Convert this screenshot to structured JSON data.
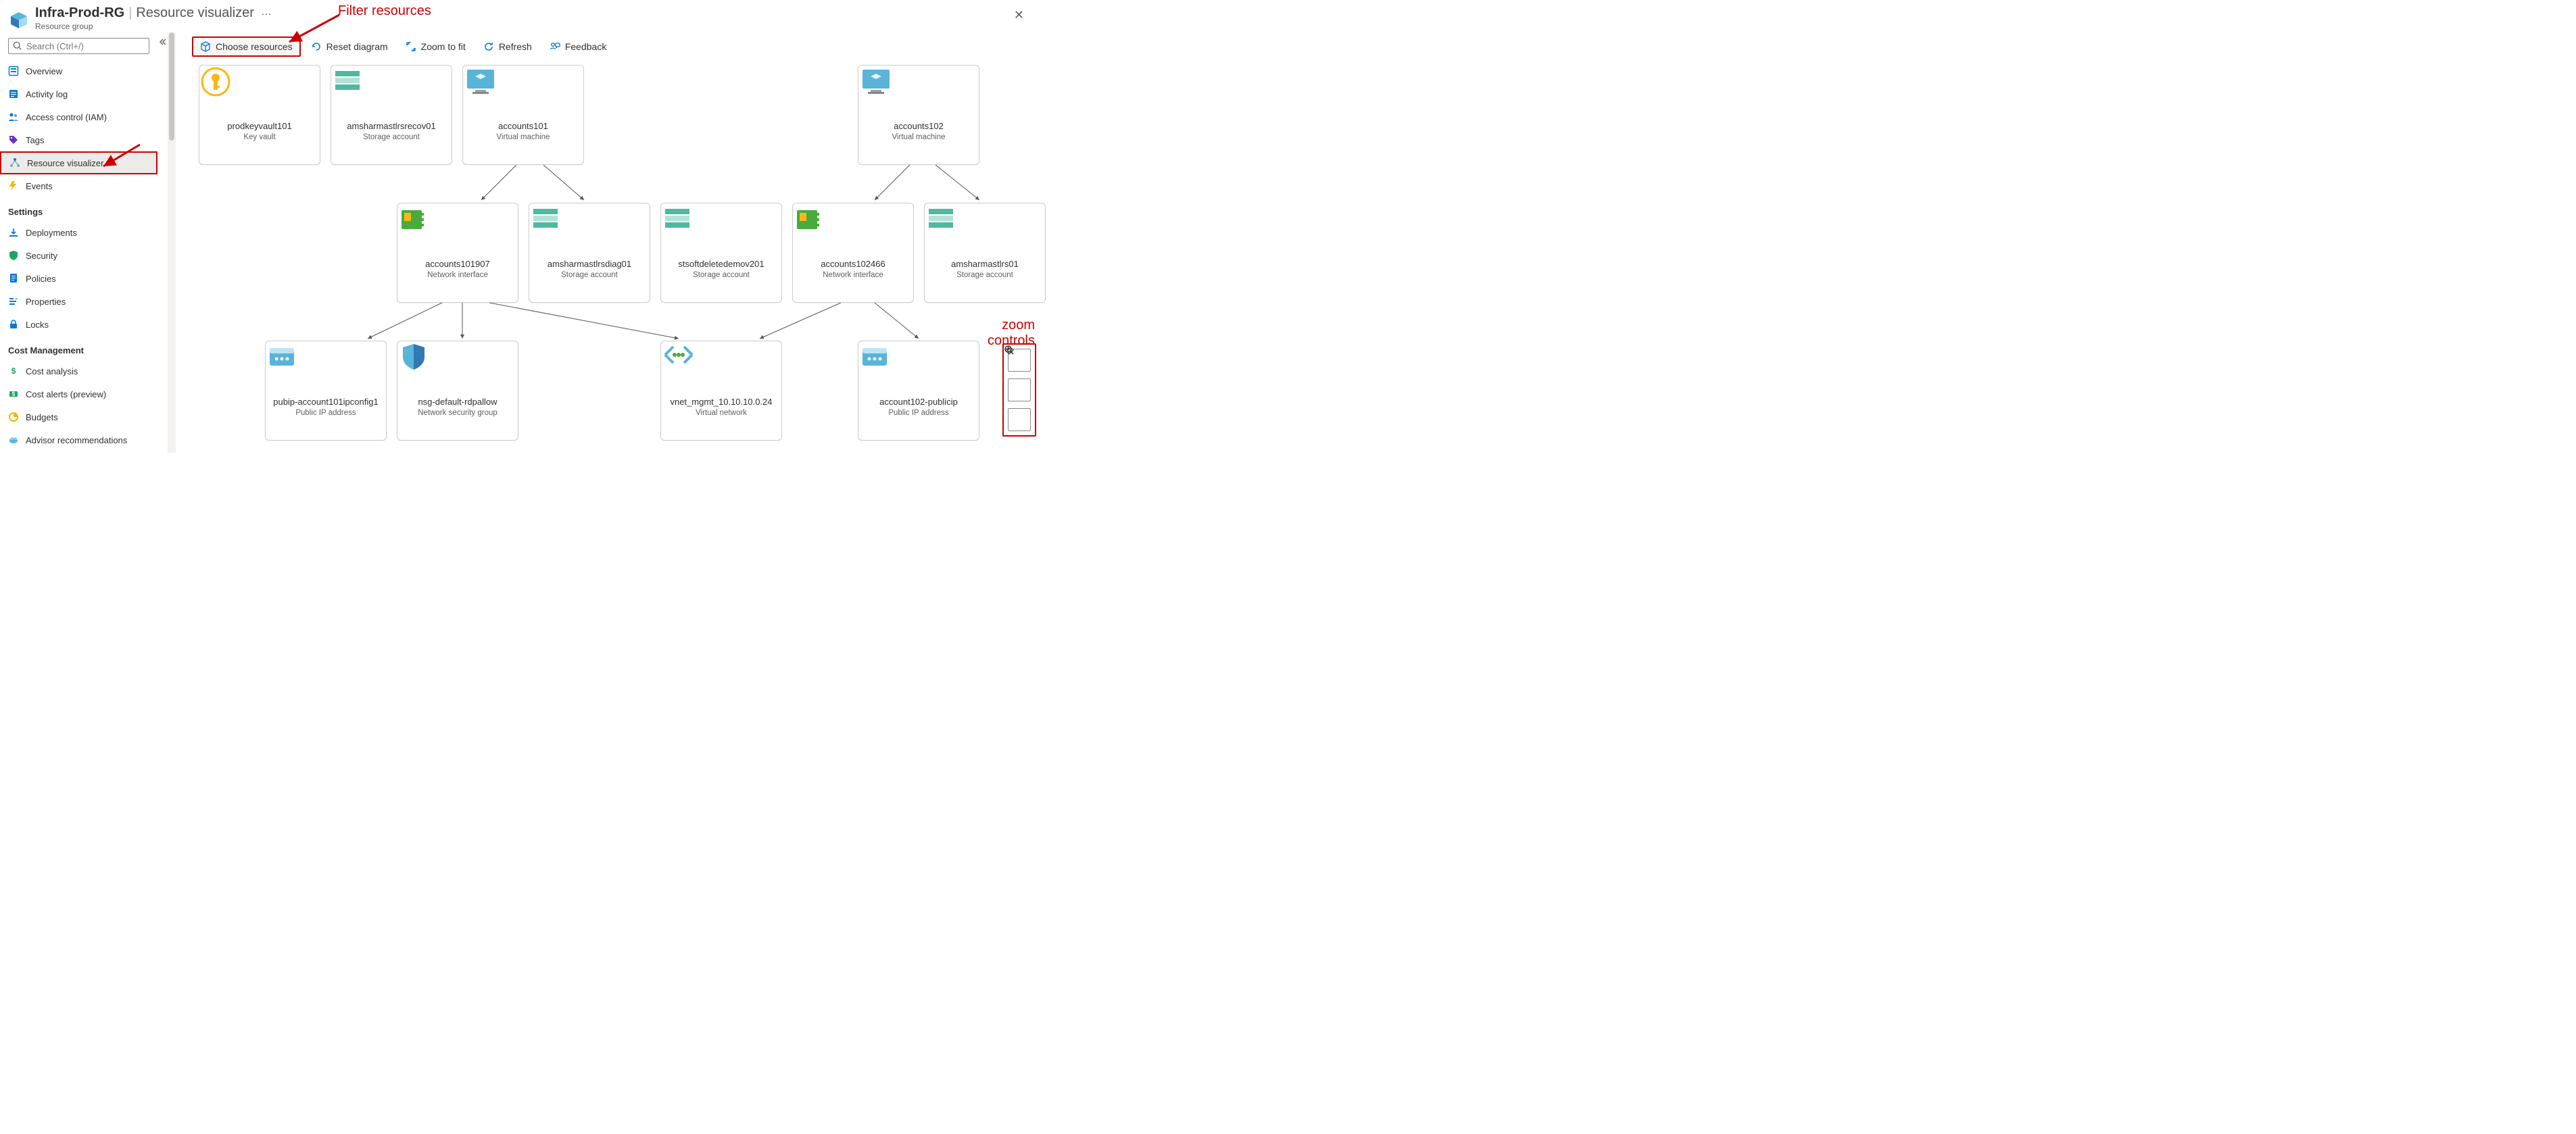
{
  "header": {
    "title_main": "Infra-Prod-RG",
    "title_separator": "|",
    "title_sub": "Resource visualizer",
    "subtitle": "Resource group",
    "more": "…"
  },
  "search": {
    "placeholder": "Search (Ctrl+/)"
  },
  "sidebar": {
    "items": [
      {
        "label": "Overview",
        "icon": "overview-icon"
      },
      {
        "label": "Activity log",
        "icon": "activitylog-icon"
      },
      {
        "label": "Access control (IAM)",
        "icon": "iam-icon"
      },
      {
        "label": "Tags",
        "icon": "tags-icon"
      },
      {
        "label": "Resource visualizer",
        "icon": "visualizer-icon",
        "selected": true
      },
      {
        "label": "Events",
        "icon": "events-icon"
      }
    ],
    "sections": [
      {
        "title": "Settings",
        "items": [
          {
            "label": "Deployments",
            "icon": "deployments-icon"
          },
          {
            "label": "Security",
            "icon": "security-icon"
          },
          {
            "label": "Policies",
            "icon": "policies-icon"
          },
          {
            "label": "Properties",
            "icon": "properties-icon"
          },
          {
            "label": "Locks",
            "icon": "locks-icon"
          }
        ]
      },
      {
        "title": "Cost Management",
        "items": [
          {
            "label": "Cost analysis",
            "icon": "costanalysis-icon"
          },
          {
            "label": "Cost alerts (preview)",
            "icon": "costalerts-icon"
          },
          {
            "label": "Budgets",
            "icon": "budgets-icon"
          },
          {
            "label": "Advisor recommendations",
            "icon": "advisor-icon"
          }
        ]
      }
    ]
  },
  "toolbar": {
    "choose": "Choose resources",
    "reset": "Reset diagram",
    "zoomfit": "Zoom to fit",
    "refresh": "Refresh",
    "feedback": "Feedback"
  },
  "nodes": {
    "n1": {
      "name": "prodkeyvault101",
      "type": "Key vault"
    },
    "n2": {
      "name": "amsharmastlrsrecov01",
      "type": "Storage account"
    },
    "n3": {
      "name": "accounts101",
      "type": "Virtual machine"
    },
    "n4": {
      "name": "accounts102",
      "type": "Virtual machine"
    },
    "n5": {
      "name": "accounts101907",
      "type": "Network interface"
    },
    "n6": {
      "name": "amsharmastlrsdiag01",
      "type": "Storage account"
    },
    "n7": {
      "name": "stsoftdeletedemov201",
      "type": "Storage account"
    },
    "n8": {
      "name": "accounts102466",
      "type": "Network interface"
    },
    "n9": {
      "name": "amsharmastlrs01",
      "type": "Storage account"
    },
    "n10": {
      "name": "pubip-account101ipconfig1",
      "type": "Public IP address"
    },
    "n11": {
      "name": "nsg-default-rdpallow",
      "type": "Network security group"
    },
    "n12": {
      "name": "vnet_mgmt_10.10.10.0.24",
      "type": "Virtual network"
    },
    "n13": {
      "name": "account102-publicip",
      "type": "Public IP address"
    }
  },
  "annotations": {
    "filter": "Filter resources",
    "zoom_line1": "zoom",
    "zoom_line2": "controls"
  }
}
